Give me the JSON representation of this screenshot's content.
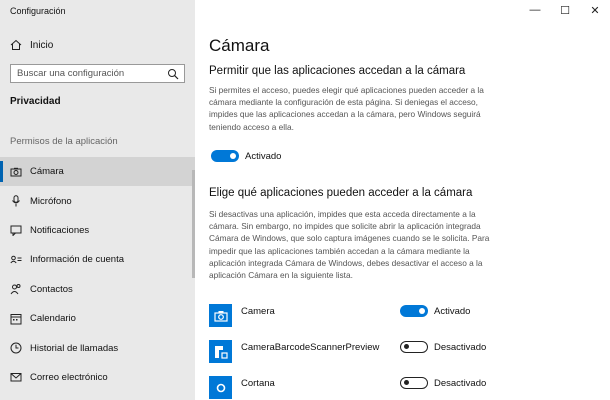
{
  "app": {
    "title": "Configuración"
  },
  "window_controls": {
    "minimize": "—",
    "maximize": "☐",
    "close": "✕"
  },
  "sidebar": {
    "home_label": "Inicio",
    "search_placeholder": "Buscar una configuración",
    "section_title": "Privacidad",
    "group_title": "Permisos de la aplicación",
    "items": [
      {
        "label": "Cámara",
        "icon": "camera-icon",
        "active": true
      },
      {
        "label": "Micrófono",
        "icon": "microphone-icon"
      },
      {
        "label": "Notificaciones",
        "icon": "notifications-icon"
      },
      {
        "label": "Información de cuenta",
        "icon": "account-info-icon"
      },
      {
        "label": "Contactos",
        "icon": "contacts-icon"
      },
      {
        "label": "Calendario",
        "icon": "calendar-icon"
      },
      {
        "label": "Historial de llamadas",
        "icon": "call-history-icon"
      },
      {
        "label": "Correo electrónico",
        "icon": "mail-icon"
      }
    ]
  },
  "main": {
    "title": "Cámara",
    "section1": {
      "heading": "Permitir que las aplicaciones accedan a la cámara",
      "description": "Si permites el acceso, puedes elegir qué aplicaciones pueden acceder a la cámara mediante la configuración de esta página. Si deniegas el acceso, impides que las aplicaciones accedan a la cámara, pero Windows seguirá teniendo acceso a ella.",
      "toggle_label": "Activado",
      "toggle_on": true
    },
    "section2": {
      "heading": "Elige qué aplicaciones pueden acceder a la cámara",
      "description": "Si desactivas una aplicación, impides que esta acceda directamente a la cámara. Sin embargo, no impides que solicite abrir la aplicación integrada Cámara de Windows, que solo captura imágenes cuando se le solicita. Para impedir que las aplicaciones también accedan a la cámara mediante la aplicación integrada Cámara de Windows, debes desactivar el acceso a la aplicación Cámara en la siguiente lista."
    },
    "apps": [
      {
        "name": "Camera",
        "state_label": "Activado",
        "on": true,
        "icon": "camera-app-icon"
      },
      {
        "name": "CameraBarcodeScannerPreview",
        "state_label": "Desactivado",
        "on": false,
        "icon": "barcode-scanner-icon"
      },
      {
        "name": "Cortana",
        "state_label": "Desactivado",
        "on": false,
        "icon": "cortana-icon"
      }
    ]
  },
  "colors": {
    "accent": "#0078d7",
    "sidebar_bg": "#e9e9e9",
    "active_bg": "#d3d3d3"
  }
}
